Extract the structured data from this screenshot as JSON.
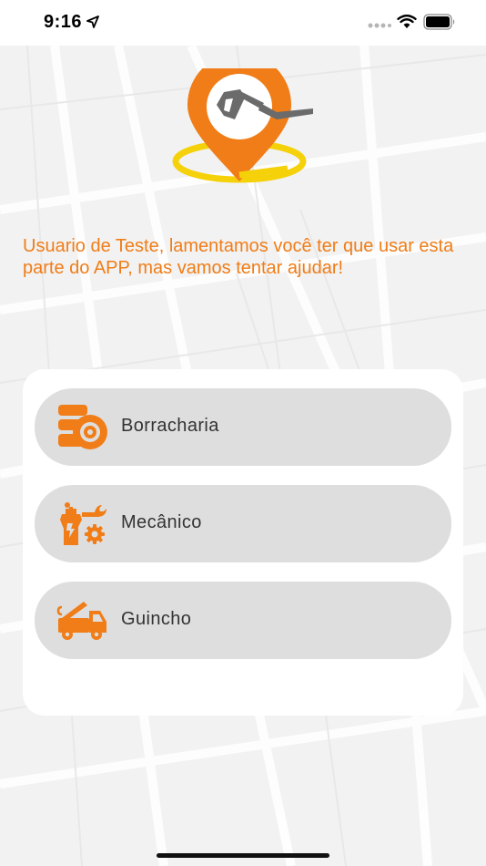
{
  "status_bar": {
    "time": "9:16"
  },
  "message": "Usuario de Teste, lamentamos você ter que usar esta parte do APP, mas vamos tentar ajudar!",
  "options": [
    {
      "label": "Borracharia",
      "icon": "tire-shop-icon"
    },
    {
      "label": "Mecânico",
      "icon": "mechanic-icon"
    },
    {
      "label": "Guincho",
      "icon": "tow-truck-icon"
    }
  ],
  "colors": {
    "accent": "#f07d17",
    "logo_yellow": "#f5d10a",
    "pump_gray": "#6b6b6b",
    "option_bg": "#dedede",
    "card_bg": "#ffffff",
    "page_bg": "#f2f2f2"
  }
}
